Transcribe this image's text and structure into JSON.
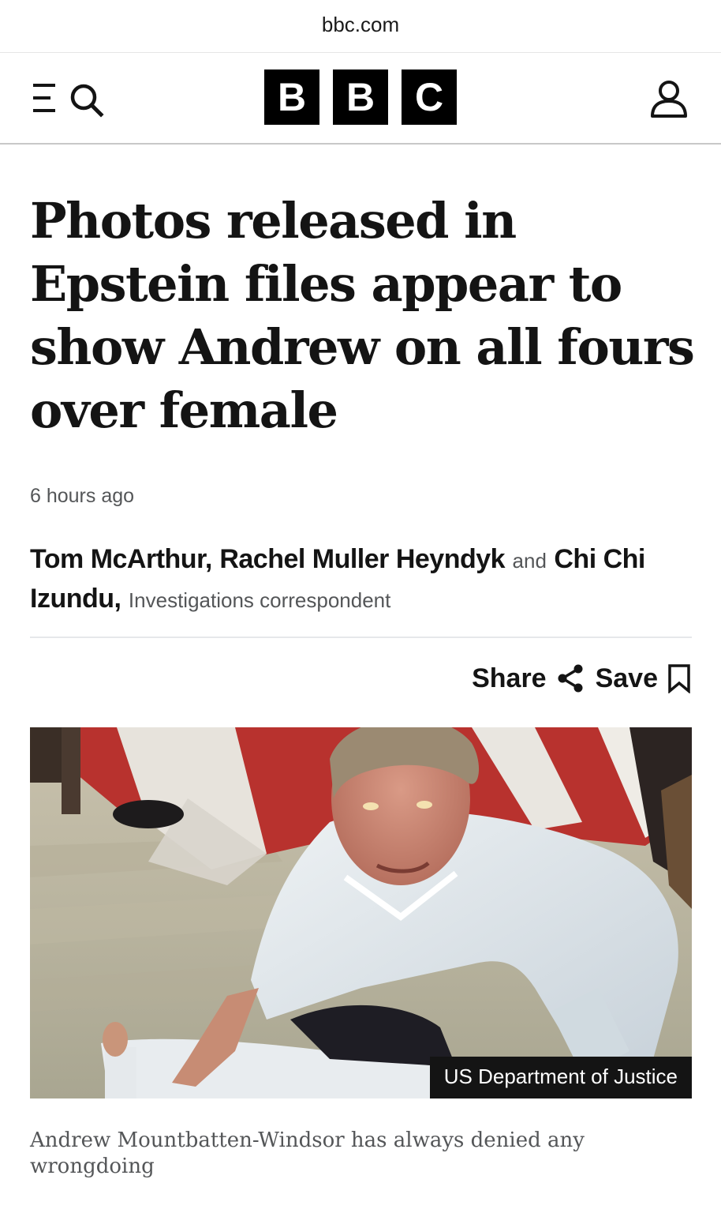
{
  "browser": {
    "url": "bbc.com"
  },
  "header": {
    "logo_letters": [
      "B",
      "B",
      "C"
    ],
    "menu_icon": "menu-icon",
    "search_icon": "search-icon",
    "account_icon": "account-icon"
  },
  "article": {
    "headline": "Photos released in Epstein files appear to show Andrew on all fours over female",
    "timestamp": "6 hours ago",
    "byline": {
      "author_1": "Tom McArthur,",
      "author_2": "Rachel Muller Heyndyk",
      "conjunction": "and",
      "author_3": "Chi Chi Izundu,",
      "role": "Investigations correspondent"
    },
    "actions": {
      "share_label": "Share",
      "share_icon": "share-icon",
      "save_label": "Save",
      "save_icon": "bookmark-icon"
    },
    "image": {
      "credit": "US Department of Justice",
      "caption": "Andrew Mountbatten-Windsor has always denied any wrongdoing"
    }
  },
  "colors": {
    "text_primary": "#141414",
    "text_secondary": "#545658",
    "logo_bg": "#000000",
    "divider": "#e6e8ea"
  }
}
